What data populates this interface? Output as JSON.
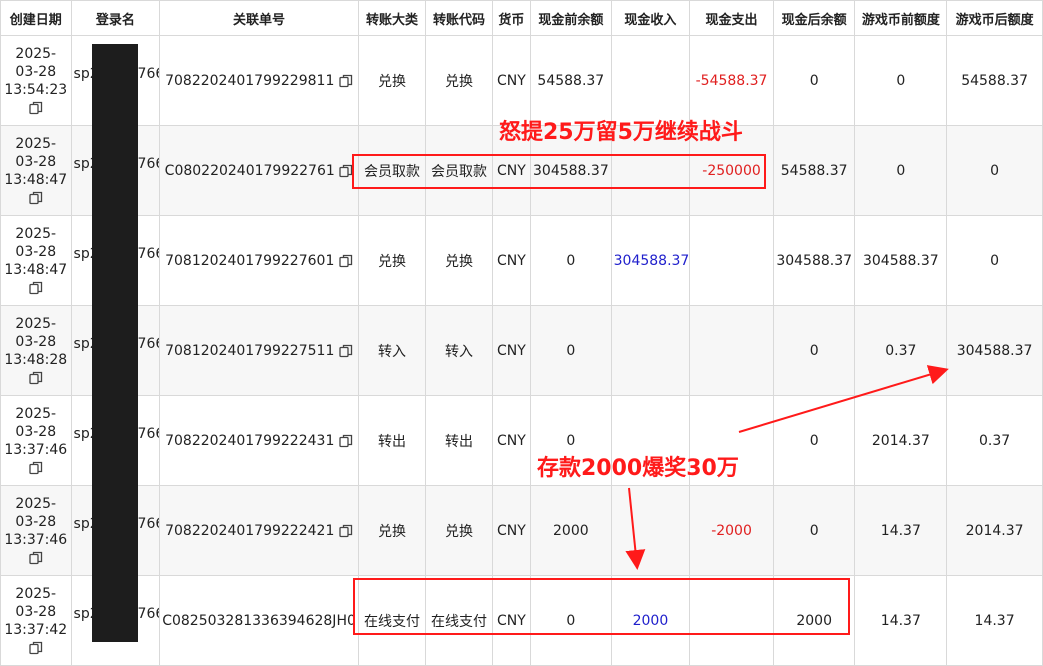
{
  "columns": [
    "创建日期",
    "登录名",
    "关联单号",
    "转账大类",
    "转账代码",
    "货币",
    "现金前余额",
    "现金收入",
    "现金支出",
    "现金后余额",
    "游戏币前额度",
    "游戏币后额度"
  ],
  "rows": [
    {
      "date": "2025-",
      "date2": "03-28",
      "time": "13:54:23",
      "login_a": "sp2",
      "login_b": "766",
      "order": "7082202401799229811",
      "category": "兑换",
      "code": "兑换",
      "currency": "CNY",
      "cash_before": "54588.37",
      "cash_in": "",
      "cash_out": "-54588.37",
      "cash_after": "0",
      "game_before": "0",
      "game_after": "54588.37"
    },
    {
      "date": "2025-",
      "date2": "03-28",
      "time": "13:48:47",
      "login_a": "sp2",
      "login_b": "766",
      "order": "C080220240179922761",
      "category": "会员取款",
      "code": "会员取款",
      "currency": "CNY",
      "cash_before": "304588.37",
      "cash_in": "",
      "cash_out": "-250000",
      "cash_after": "54588.37",
      "game_before": "0",
      "game_after": "0"
    },
    {
      "date": "2025-",
      "date2": "03-28",
      "time": "13:48:47",
      "login_a": "sp2",
      "login_b": "766",
      "order": "7081202401799227601",
      "category": "兑换",
      "code": "兑换",
      "currency": "CNY",
      "cash_before": "0",
      "cash_in": "304588.37",
      "cash_out": "",
      "cash_after": "304588.37",
      "game_before": "304588.37",
      "game_after": "0"
    },
    {
      "date": "2025-",
      "date2": "03-28",
      "time": "13:48:28",
      "login_a": "sp2",
      "login_b": "766",
      "order": "7081202401799227511",
      "category": "转入",
      "code": "转入",
      "currency": "CNY",
      "cash_before": "0",
      "cash_in": "",
      "cash_out": "",
      "cash_after": "0",
      "game_before": "0.37",
      "game_after": "304588.37"
    },
    {
      "date": "2025-",
      "date2": "03-28",
      "time": "13:37:46",
      "login_a": "sp2",
      "login_b": "766",
      "order": "7082202401799222431",
      "category": "转出",
      "code": "转出",
      "currency": "CNY",
      "cash_before": "0",
      "cash_in": "",
      "cash_out": "",
      "cash_after": "0",
      "game_before": "2014.37",
      "game_after": "0.37"
    },
    {
      "date": "2025-",
      "date2": "03-28",
      "time": "13:37:46",
      "login_a": "sp2",
      "login_b": "766",
      "order": "7082202401799222421",
      "category": "兑换",
      "code": "兑换",
      "currency": "CNY",
      "cash_before": "2000",
      "cash_in": "",
      "cash_out": "-2000",
      "cash_after": "0",
      "game_before": "14.37",
      "game_after": "2014.37"
    },
    {
      "date": "2025-",
      "date2": "03-28",
      "time": "13:37:42",
      "login_a": "sp2",
      "login_b": "766",
      "order": "C082503281336394628JH0",
      "category": "在线支付",
      "code": "在线支付",
      "currency": "CNY",
      "cash_before": "0",
      "cash_in": "2000",
      "cash_out": "",
      "cash_after": "2000",
      "game_before": "14.37",
      "game_after": "14.37"
    }
  ],
  "annotations": {
    "withdraw_note": "怒提25万留5万继续战斗",
    "deposit_note": "存款2000爆奖30万"
  },
  "colors": {
    "annotation": "#ff1a1a",
    "negative": "#e02020",
    "positive": "#1f1fcc",
    "redaction": "#1d1d1d"
  },
  "icons": {
    "copy": "copy-icon"
  }
}
